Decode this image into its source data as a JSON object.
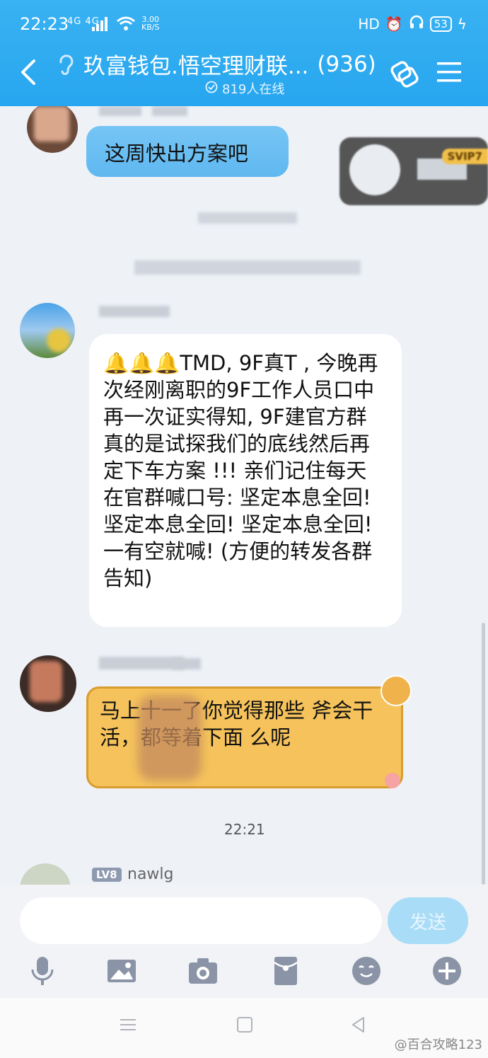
{
  "status_bar": {
    "time": "22:23",
    "network": "4G 4G",
    "speed_value": "3.00",
    "speed_unit": "KB/S",
    "hd_label": "HD",
    "battery": "53"
  },
  "header": {
    "title": "玖富钱包.悟空理财联...",
    "member_count": "(936)",
    "online_text": "819人在线"
  },
  "messages": {
    "m1": {
      "text": "这周快出方案吧",
      "badge": "SVIP7"
    },
    "m2": {
      "text": "🔔🔔🔔TMD, 9F真T  , 今晚再次经刚离职的9F工作人员口中再一次证实得知, 9F建官方群真的是试探我们的底线然后再定下车方案 !!! 亲们记住每天在官群喊口号: 坚定本息全回! 坚定本息全回! 坚定本息全回! 一有空就喊! (方便的转发各群告知)"
    },
    "m3": {
      "text": "马上十一了你觉得那些 斧会干活，都等着下面 么呢"
    },
    "timestamp": "22:21",
    "m4": {
      "level": "LV8",
      "sender": "nawlg"
    }
  },
  "input_bar": {
    "placeholder": "",
    "send_label": "发送"
  },
  "watermark": "@百合攻略123",
  "icons": {
    "back": "back-arrow-icon",
    "ear": "ear-icon",
    "online": "check-circle-icon",
    "share": "group-share-icon",
    "menu": "menu-icon",
    "mic": "microphone-icon",
    "image": "image-icon",
    "camera": "camera-icon",
    "redpacket": "red-packet-icon",
    "emoji": "emoji-icon",
    "plus": "plus-icon"
  },
  "colors": {
    "header_bg": "#2aa8ef",
    "blue_bubble": "#6bbef3",
    "yellow_bubble": "#f5c25b",
    "send_button": "#a9dcf7"
  }
}
